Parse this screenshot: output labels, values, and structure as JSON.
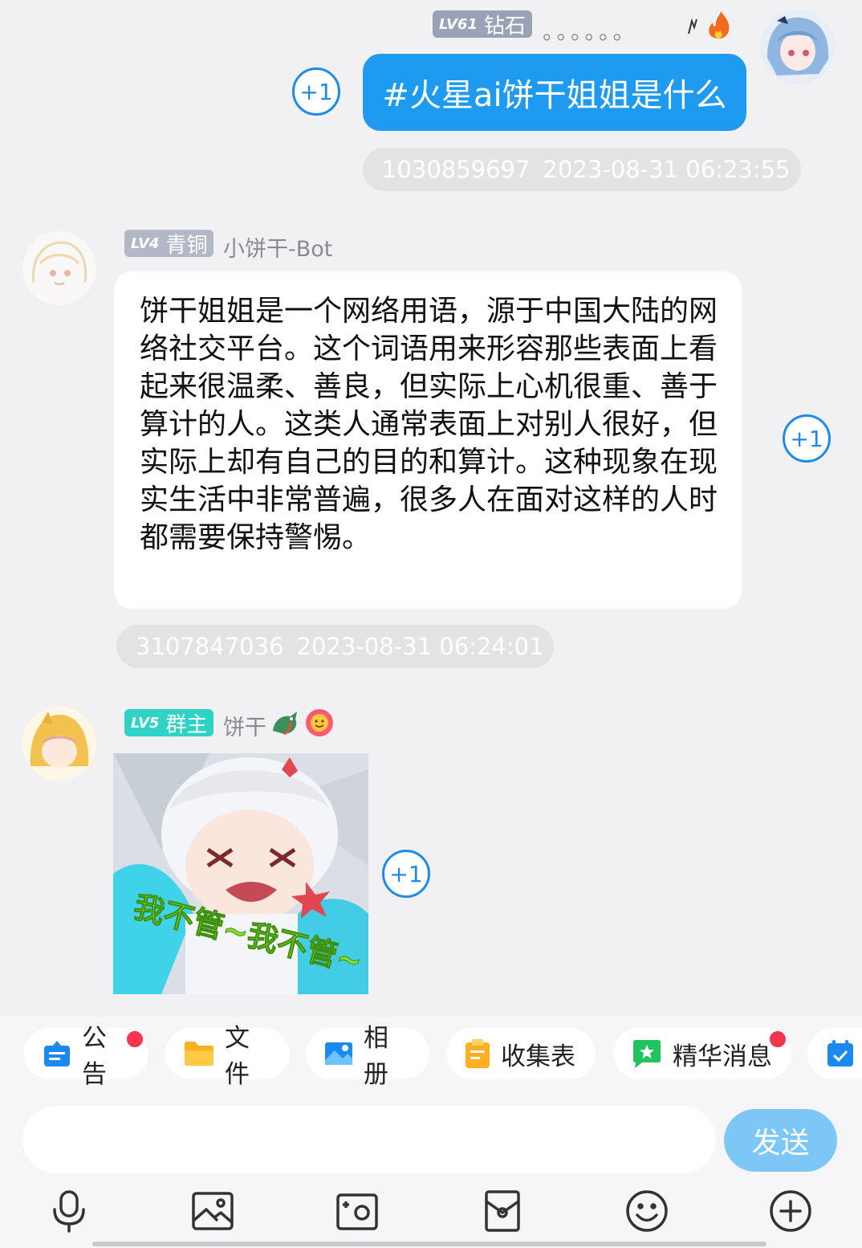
{
  "messages": {
    "m1": {
      "level": "LV61",
      "title": "钻石",
      "name": "。。。。。。",
      "text": "#火星ai饼干姐姐是什么",
      "sender_id": "1030859697",
      "time": "2023-08-31 06:23:55",
      "plus": "+1"
    },
    "m2": {
      "level": "LV4",
      "title": "青铜",
      "name": "小饼干-Bot",
      "text": "饼干姐姐是一个网络用语，源于中国大陆的网络社交平台。这个词语用来形容那些表面上看起来很温柔、善良，但实际上心机很重、善于算计的人。这类人通常表面上对别人很好，但实际上却有自己的目的和算计。这种现象在现实生活中非常普遍，很多人在面对这样的人时都需要保持警惕。",
      "sender_id": "3107847036",
      "time": "2023-08-31 06:24:01",
      "plus": "+1"
    },
    "m3": {
      "level": "LV5",
      "title": "群主",
      "name": "饼干",
      "sticker_caption": "我不管~我不管~",
      "plus": "+1"
    }
  },
  "toolbar": {
    "chips": [
      "公告",
      "文件",
      "相册",
      "收集表",
      "精华消息"
    ]
  },
  "input": {
    "placeholder": "",
    "send_label": "发送"
  },
  "colors": {
    "accent": "#1f8be8",
    "bubble_self": "#1e9af0",
    "badge_diamond": "#9aa3b5",
    "badge_bronze": "#b3b8c6",
    "badge_owner": "#2fd3c6",
    "unread_dot": "#f5354f"
  }
}
